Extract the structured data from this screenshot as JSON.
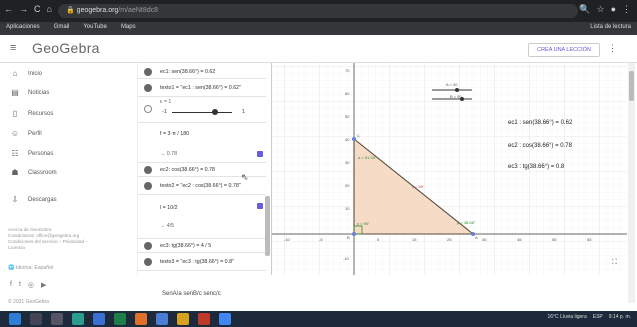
{
  "browser": {
    "nav_icons": [
      "←",
      "→",
      "C",
      "⌂"
    ],
    "url": "geogebra.org",
    "url_path": "/m/aeNt8dc8",
    "bookmarks": [
      "Aplicaciones",
      "Gmail",
      "YouTube",
      "Maps"
    ],
    "reading_list": "Lista de lectura"
  },
  "header": {
    "logo": "GeoGebra",
    "lesson_button": "CREA UNA LECCIÓN"
  },
  "leftnav": {
    "items": [
      {
        "icon": "home-icon",
        "glyph": "⌂",
        "label": "Inicio"
      },
      {
        "icon": "news-icon",
        "glyph": "▤",
        "label": "Noticias"
      },
      {
        "icon": "resources-icon",
        "glyph": "▯",
        "label": "Recursos"
      },
      {
        "icon": "profile-icon",
        "glyph": "☺",
        "label": "Perfil"
      },
      {
        "icon": "people-icon",
        "glyph": "☷",
        "label": "Personas"
      },
      {
        "icon": "classroom-icon",
        "glyph": "☗",
        "label": "Classroom"
      },
      {
        "icon": "download-icon",
        "glyph": "⇩",
        "label": "Descargas"
      }
    ],
    "footer": [
      "Acerca de GeoGebra",
      "Contáctanos: office@geogebra.org",
      "Condiciones del servicio – Privacidad –",
      "Licencia"
    ],
    "language": "Idioma: Español",
    "copyright": "© 2021 GeoGebra"
  },
  "algebra": {
    "rows": [
      {
        "text": "ec1: sen(38.66°) = 0.62",
        "bullet": "filled"
      },
      {
        "text": "texto1 = \"ec1 : sen(38.66°) = 0.62\"",
        "bullet": "filled"
      },
      {
        "text": "ε = 1",
        "bullet": "hollow"
      },
      {
        "text": "-1",
        "bullet": "none"
      },
      {
        "text": "1",
        "bullet": "none"
      },
      {
        "text": "f = 3·π / 180",
        "bullet": "none"
      },
      {
        "text": "→ 0.78",
        "bullet": "none"
      },
      {
        "text": "ec2: cos(38.66°) = 0.78",
        "bullet": "filled"
      },
      {
        "text": "texto2 = \"ec2 : cos(38.66°) = 0.78\"",
        "bullet": "filled"
      },
      {
        "text": "l = 10/2",
        "bullet": "none"
      },
      {
        "text": "→ 4/5",
        "bullet": "none"
      },
      {
        "text": "ec3: tg(38.66°) = 4 / 5",
        "bullet": "filled"
      },
      {
        "text": "texto3 = \"ec3 : tg(38.66°) = 0.8\"",
        "bullet": "filled"
      }
    ]
  },
  "graphics": {
    "sliders": [
      "A = 40",
      "B = 50"
    ],
    "eq_labels": [
      "ec1 : sen(38.66°) = 0.62",
      "ec2 : cos(38.66°) = 0.78",
      "ec3 : tg(38.66°) = 0.8"
    ],
    "angle_alpha": "α = 51.34°",
    "angle_beta": "β = 38.66°",
    "angle_right": "γ = 90°",
    "side_label": "c = 50",
    "point_labels": [
      "C",
      "B",
      "A"
    ],
    "x_ticks": [
      "-10",
      "-5",
      "5",
      "10",
      "15",
      "20",
      "25",
      "30",
      "35",
      "40",
      "45",
      "50",
      "55",
      "60",
      "65",
      "70",
      "75"
    ],
    "y_ticks": [
      "70",
      "60",
      "50",
      "40",
      "30",
      "20",
      "10",
      "-10"
    ]
  },
  "bottom_text": "SenA/a senB/c senc/c",
  "taskbar": {
    "weather": "16°C  Lluvia ligera",
    "time": "9:14 p. m.",
    "lang": "ESP"
  },
  "colors": {
    "triangle_fill": "#f6dcc6",
    "triangle_stroke": "#5a4a3a",
    "accent": "#6a5ee0",
    "taskbar": "#1c2a3b"
  }
}
